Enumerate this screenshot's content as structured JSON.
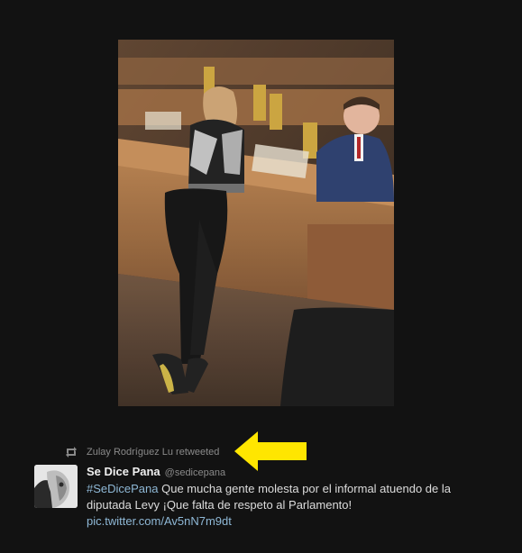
{
  "retweet": {
    "icon": "retweet-icon",
    "text": "Zulay Rodríguez Lu retweeted"
  },
  "annotation": {
    "icon": "yellow-arrow-pointer",
    "color": "#ffe600"
  },
  "tweet": {
    "avatar_icon": "profile-avatar",
    "fullname": "Se Dice Pana",
    "username": "@sedicepana",
    "hashtag": "#SeDicePana",
    "text": " Que mucha gente molesta por el informal atuendo de la diputada Levy ¡Que falta de respeto al Parlamento!",
    "link": "pic.twitter.com/Av5nN7m9dt"
  },
  "colors": {
    "background": "#121212",
    "link": "#8fb8d6",
    "meta": "#8a8a8a"
  }
}
